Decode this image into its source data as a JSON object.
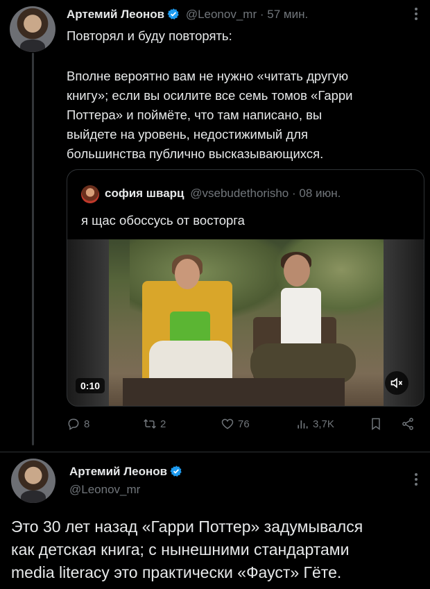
{
  "tweet1": {
    "author_name": "Артемий Леонов",
    "handle": "@Leonov_mr",
    "dot": "·",
    "time": "57 мин.",
    "intro": "Повторял и буду повторять:",
    "body_lines": [
      "Вполне вероятно вам не нужно «читать другую",
      "книгу»; если вы осилите все семь томов «Гарри",
      "Поттера» и поймёте, что там написано, вы",
      "выйдете на уровень, недостижимый для",
      "большинства публично высказывающихся."
    ],
    "quote": {
      "author_name": "софия шварц",
      "handle": "@vsebudethorisho",
      "dot": "·",
      "date": "08 июн.",
      "text": "я щас обоссусь от восторга",
      "video_duration": "0:10"
    },
    "actions": {
      "replies": "8",
      "reposts": "2",
      "likes": "76",
      "views": "3,7K"
    }
  },
  "tweet2": {
    "author_name": "Артемий Леонов",
    "handle": "@Leonov_mr",
    "body_lines": [
      "Это 30 лет назад «Гарри Поттер» задумывался",
      "как детская книга; с нынешними стандартами",
      "media literacy это практически «Фауст» Гёте."
    ]
  },
  "colors": {
    "background": "#000000",
    "text": "#e7e9ea",
    "muted": "#71767b",
    "verified": "#1d9bf0",
    "border": "#2f3336"
  },
  "icons": [
    "verified-badge-icon",
    "more-icon",
    "reply-icon",
    "repost-icon",
    "like-icon",
    "views-icon",
    "bookmark-icon",
    "share-icon",
    "muted-speaker-icon"
  ]
}
